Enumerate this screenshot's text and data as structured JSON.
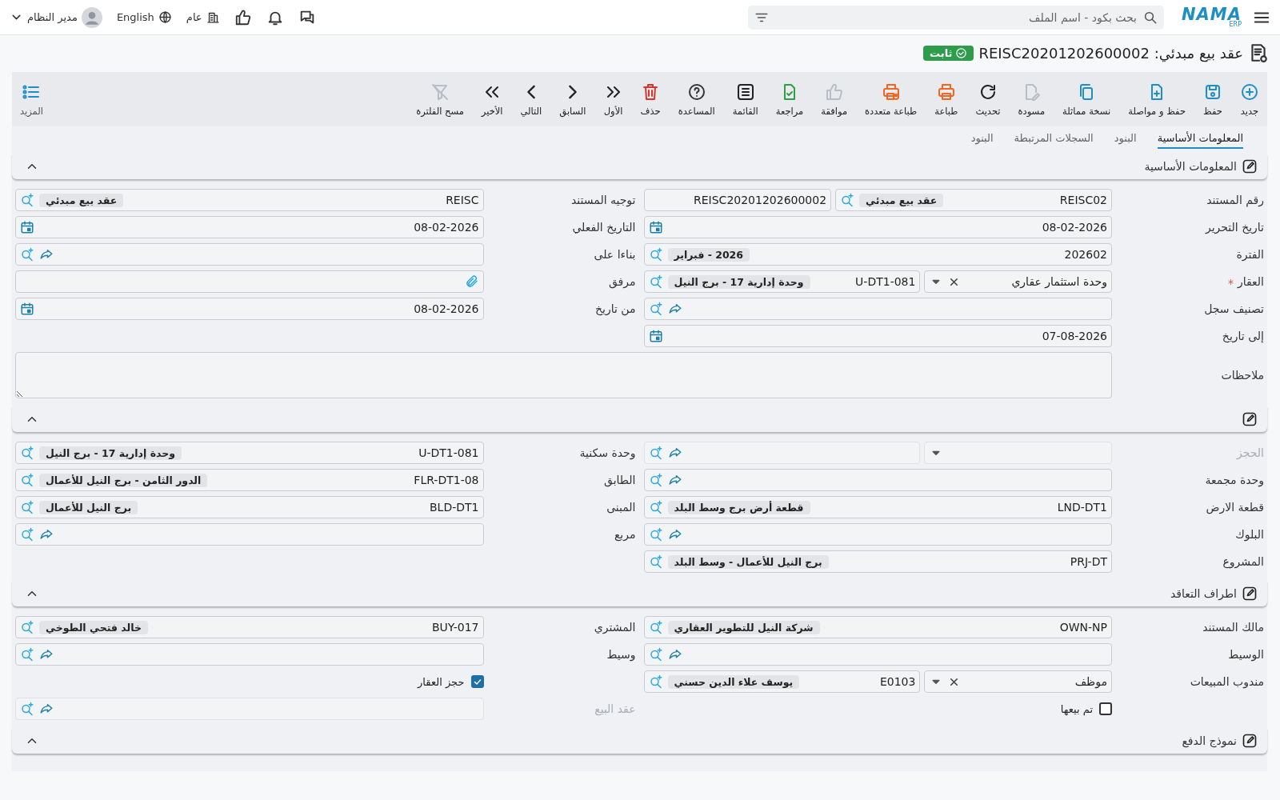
{
  "topbar": {
    "logo": "NAMA",
    "logo_sub": "ERP",
    "search_placeholder": "بحث بكود - اسم الملف",
    "branch": "عام",
    "language": "English",
    "user": "مدير النظام"
  },
  "title": {
    "text": "عقد بيع مبدئي: REISC20201202600002",
    "status": "ثابت"
  },
  "toolbar": {
    "items": [
      {
        "kind": "new",
        "label": "جديد",
        "disabled": false
      },
      {
        "kind": "save",
        "label": "حفظ",
        "disabled": false
      },
      {
        "kind": "save-continue",
        "label": "حفظ و مواصلة",
        "disabled": false
      },
      {
        "kind": "copy",
        "label": "نسخة مماثلة",
        "disabled": false
      },
      {
        "kind": "draft",
        "label": "مسودة",
        "disabled": true
      },
      {
        "kind": "refresh",
        "label": "تحديث",
        "disabled": false
      },
      {
        "kind": "print",
        "label": "طباعة",
        "disabled": false
      },
      {
        "kind": "print-multi",
        "label": "طباعة متعددة",
        "disabled": false
      },
      {
        "kind": "approve",
        "label": "موافقة",
        "disabled": true
      },
      {
        "kind": "review",
        "label": "مراجعة",
        "disabled": false
      },
      {
        "kind": "list",
        "label": "القائمة",
        "disabled": false
      },
      {
        "kind": "help",
        "label": "المساعدة",
        "disabled": false
      },
      {
        "kind": "delete",
        "label": "حذف",
        "disabled": false
      },
      {
        "kind": "first",
        "label": "الأول",
        "disabled": false
      },
      {
        "kind": "previous",
        "label": "السابق",
        "disabled": false
      },
      {
        "kind": "next",
        "label": "التالي",
        "disabled": false
      },
      {
        "kind": "last",
        "label": "الأخير",
        "disabled": false
      },
      {
        "kind": "clear-filter",
        "label": "مسح الفلترة",
        "disabled": true
      }
    ],
    "more": {
      "label": "المزيد"
    }
  },
  "tabs": [
    {
      "label": "المعلومات الأساسية",
      "selected": true
    },
    {
      "label": "البنود",
      "selected": false
    },
    {
      "label": "السجلات المرتبطة",
      "selected": false
    },
    {
      "label": "البنود",
      "selected": false
    }
  ],
  "sections": [
    {
      "title": "المعلومات الأساسية",
      "expanded": true,
      "right": [
        {
          "kind": "number-lookup",
          "label": "رقم المستند",
          "code": "REISC02",
          "name": "عقد بيع مبدئي",
          "number": "REISC20201202600002"
        },
        {
          "kind": "date",
          "label": "تاريخ التحرير",
          "value": "08-02-2026"
        },
        {
          "kind": "lookup",
          "label": "الفترة",
          "code": "202602",
          "name": "2026 - فبراير"
        },
        {
          "kind": "select-lookup",
          "label": "العقار",
          "required": true,
          "option": "وحدة استثمار عقاري",
          "clearable": true,
          "code": "U-DT1-081",
          "name": "وحدة إدارية 17 - برج النيل"
        },
        {
          "kind": "lookup",
          "label": "تصنيف سجل",
          "jump": true
        },
        {
          "kind": "date",
          "label": "إلى تاريخ",
          "value": "07-08-2026"
        }
      ],
      "left": [
        {
          "kind": "lookup",
          "label": "توجيه المستند",
          "code": "REISC",
          "name": "عقد بيع مبدئي"
        },
        {
          "kind": "date",
          "label": "التاريخ الفعلي",
          "value": "08-02-2026"
        },
        {
          "kind": "lookup",
          "label": "بناءا على",
          "jump": true
        },
        {
          "kind": "attachment",
          "label": "مرفق"
        },
        {
          "kind": "date",
          "label": "من تاريخ",
          "value": "08-02-2026"
        }
      ],
      "notes": {
        "label": "ملاحظات"
      }
    },
    {
      "expanded": true,
      "right": [
        {
          "kind": "select-lookup",
          "label": "الحجز",
          "disabled": true,
          "jump": true
        },
        {
          "kind": "lookup",
          "label": "وحدة مجمعة",
          "jump": true
        },
        {
          "kind": "lookup",
          "label": "قطعة الارض",
          "code": "LND-DT1",
          "name": "قطعة أرض برج وسط البلد"
        },
        {
          "kind": "lookup",
          "label": "البلوك",
          "jump": true
        },
        {
          "kind": "lookup",
          "label": "المشروع",
          "code": "PRJ-DT",
          "name": "برج النيل للأعمال - وسط البلد"
        }
      ],
      "left": [
        {
          "kind": "lookup",
          "label": "وحدة سكنية",
          "code": "U-DT1-081",
          "name": "وحدة إدارية 17 - برج النيل"
        },
        {
          "kind": "lookup",
          "label": "الطابق",
          "code": "FLR-DT1-08",
          "name": "الدور الثامن - برج النيل للأعمال"
        },
        {
          "kind": "lookup",
          "label": "المبنى",
          "code": "BLD-DT1",
          "name": "برج النيل للأعمال"
        },
        {
          "kind": "lookup",
          "label": "مربع",
          "jump": true
        }
      ]
    },
    {
      "title": "اطراف التعاقد",
      "expanded": true,
      "right": [
        {
          "kind": "lookup",
          "label": "مالك المستند",
          "code": "OWN-NP",
          "name": "شركة النيل للتطوير العقاري"
        },
        {
          "kind": "lookup",
          "label": "الوسيط",
          "jump": true
        },
        {
          "kind": "select-lookup",
          "label": "مندوب المبيعات",
          "option": "موظف",
          "clearable": true,
          "code": "E0103",
          "name": "يوسف علاء الدين حسني"
        },
        {
          "kind": "checkbox",
          "label": "تم بيعها",
          "checked": false
        }
      ],
      "left": [
        {
          "kind": "lookup",
          "label": "المشتري",
          "code": "BUY-017",
          "name": "خالد فتحي الطوخي"
        },
        {
          "kind": "lookup",
          "label": "وسيط",
          "jump": true
        },
        {
          "kind": "checkbox",
          "label": "حجز العقار",
          "checked": true
        },
        {
          "kind": "lookup",
          "label": "عقد البيع",
          "jump": true,
          "disabled": true
        }
      ]
    },
    {
      "title": "نموذج الدفع",
      "expanded": true
    }
  ]
}
